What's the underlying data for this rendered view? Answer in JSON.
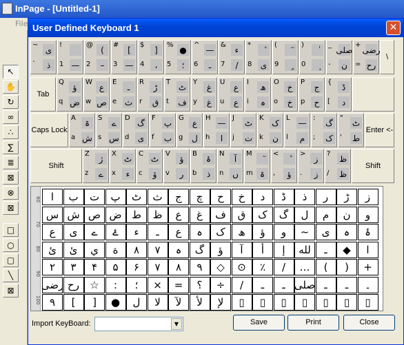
{
  "app": {
    "title": "InPage - [Untitled-1]",
    "menu": "File"
  },
  "dialog": {
    "title": "User Defined Keyboard 1",
    "close": "✕",
    "keyboard": {
      "rows": [
        {
          "keys": [
            {
              "top": "~",
              "bottom": "`",
              "c": [
                "ی",
                "ذ"
              ]
            },
            {
              "top": "!",
              "bottom": "1",
              "c": [
                "",
                "—"
              ]
            },
            {
              "top": "@",
              "bottom": "2",
              "c": [
                "(",
                "–"
              ]
            },
            {
              "top": "#",
              "bottom": "3",
              "c": [
                "[",
                "—"
              ]
            },
            {
              "top": "$",
              "bottom": "4",
              "c": [
                "]",
                "،"
              ]
            },
            {
              "top": "%",
              "bottom": "5",
              "c": [
                "●",
                "؛"
              ]
            },
            {
              "top": "^",
              "bottom": "6",
              "c": [
                "—",
                "ـ"
              ]
            },
            {
              "top": "&",
              "bottom": "7",
              "c": [
                "ء",
                "/"
              ]
            },
            {
              "top": "*",
              "bottom": "8",
              "c": [
                "ٔ",
                "ی"
              ]
            },
            {
              "top": "(",
              "bottom": "9",
              "c": [
                "ٓ",
                "ٍ"
              ]
            },
            {
              "top": ")",
              "bottom": "0",
              "c": [
                "ٰ",
                "ٖ"
              ]
            },
            {
              "top": "_",
              "bottom": "-",
              "c": [
                "صلی",
                "ن"
              ]
            },
            {
              "top": "+",
              "bottom": "=",
              "c": [
                "رضی",
                "رح"
              ]
            }
          ],
          "back": "\\"
        },
        {
          "tab": "Tab",
          "keys": [
            {
              "top": "Q",
              "bottom": "q",
              "c": [
                "ؤ",
                "ض"
              ]
            },
            {
              "top": "W",
              "bottom": "w",
              "c": [
                "ع",
                "ص"
              ]
            },
            {
              "top": "E",
              "bottom": "e",
              "c": [
                "ـ",
                "ث"
              ]
            },
            {
              "top": "R",
              "bottom": "r",
              "c": [
                "ڑ",
                "ق"
              ]
            },
            {
              "top": "T",
              "bottom": "t",
              "c": [
                "ٹ",
                "ف"
              ]
            },
            {
              "top": "Y",
              "bottom": "y",
              "c": [
                "غ",
                "غ"
              ]
            },
            {
              "top": "U",
              "bottom": "u",
              "c": [
                "ع",
                "ع"
              ]
            },
            {
              "top": "I",
              "bottom": "i",
              "c": [
                "ھ",
                "ہ"
              ]
            },
            {
              "top": "O",
              "bottom": "o",
              "c": [
                "خ",
                "خ"
              ]
            },
            {
              "top": "P",
              "bottom": "p",
              "c": [
                "ج",
                "ح"
              ]
            },
            {
              "top": "{",
              "bottom": "[",
              "c": [
                "ڈ",
                "د"
              ]
            }
          ]
        },
        {
          "caps": "Caps Lock",
          "keys": [
            {
              "top": "A",
              "bottom": "a",
              "c": [
                "ۃ",
                "ش"
              ]
            },
            {
              "top": "S",
              "bottom": "s",
              "c": [
                "ے",
                "س"
              ]
            },
            {
              "top": "D",
              "bottom": "d",
              "c": [
                "گ",
                "ی"
              ]
            },
            {
              "top": "F",
              "bottom": "f",
              "c": [
                "پ",
                "ب"
              ]
            },
            {
              "top": "G",
              "bottom": "g",
              "c": [
                "ع",
                "ل"
              ]
            },
            {
              "top": "H",
              "bottom": "h",
              "c": [
                "—",
                "ا"
              ]
            },
            {
              "top": "J",
              "bottom": "j",
              "c": [
                "ٹ",
                "ت"
              ]
            },
            {
              "top": "K",
              "bottom": "k",
              "c": [
                "ک",
                "ن"
              ]
            },
            {
              "top": "L",
              "bottom": "l",
              "c": [
                "—",
                "م"
              ]
            },
            {
              "top": ":",
              "bottom": ";",
              "c": [
                "گ",
                "ک"
              ]
            },
            {
              "top": "\"",
              "bottom": "'",
              "c": [
                "ٹ",
                "ط"
              ]
            }
          ],
          "enter": "Enter <-"
        },
        {
          "shift_left": "Shift",
          "keys": [
            {
              "top": "Z",
              "bottom": "z",
              "c": [
                "ژ",
                "ے"
              ]
            },
            {
              "top": "X",
              "bottom": "x",
              "c": [
                "ٹ",
                "ء"
              ]
            },
            {
              "top": "C",
              "bottom": "c",
              "c": [
                "ٹ",
                "ۆ"
              ]
            },
            {
              "top": "V",
              "bottom": "v",
              "c": [
                "ؤ",
                "ر"
              ]
            },
            {
              "top": "B",
              "bottom": "b",
              "c": [
                "ۂ",
                "ذ"
              ]
            },
            {
              "top": "N",
              "bottom": "n",
              "c": [
                "آ",
                "ں"
              ]
            },
            {
              "top": "M",
              "bottom": "m",
              "c": [
                "ٓ",
                "ۃ"
              ]
            },
            {
              "top": "<",
              "bottom": ",",
              "c": [
                "ٔ",
                "ؤ"
              ]
            },
            {
              "top": ">",
              "bottom": ".",
              "c": [
                "ز",
                "ز"
              ]
            },
            {
              "top": "?",
              "bottom": "/",
              "c": [
                "ظ",
                "ظ"
              ]
            }
          ],
          "shift_right": "Shift"
        }
      ]
    },
    "ruler_labels": [
      "60",
      "70",
      "80",
      "90",
      "100"
    ],
    "glyph_rows": [
      [
        "ا",
        "ب",
        "ت",
        "پ",
        "ٹ",
        "ث",
        "ج",
        "چ",
        "ح",
        "خ",
        "د",
        "ڈ",
        "ذ",
        "ر",
        "ڑ",
        "ز"
      ],
      [
        "س",
        "ش",
        "ص",
        "ض",
        "ط",
        "ظ",
        "ع",
        "غ",
        "ف",
        "ق",
        "ک",
        "گ",
        "ل",
        "م",
        "ن",
        "و"
      ],
      [
        "ع",
        "ی",
        "ے",
        "ۓ",
        "ء",
        "ـ",
        "ع",
        "ہ",
        "ک",
        "ھ",
        "ؤ",
        "و",
        "~",
        "ی",
        "ہ",
        "ۂ"
      ],
      [
        "ئ",
        "ئ",
        "ي",
        "ة",
        "۸",
        "۷",
        "ہ",
        "گ",
        "ؤ",
        "آ",
        "أ",
        "إ",
        "لله",
        "ـ",
        "◆",
        "ا"
      ],
      [
        "۲",
        "۳",
        "۴",
        "۵",
        "۶",
        "۷",
        "۸",
        "۹",
        "◇",
        "⊙",
        "٪",
        "/",
        "…",
        "(",
        ")",
        "+"
      ],
      [
        "رضی",
        "رح",
        "☆",
        ":",
        "؛",
        "×",
        "=",
        "؟",
        "÷",
        "/",
        "ـ",
        "ـ",
        "صلی",
        "ـ",
        "ـ",
        "۔"
      ],
      [
        "۹",
        "[",
        "]",
        "●",
        "ل",
        "لا",
        "لآ",
        "لأ",
        "لإ",
        "▯",
        "▯",
        "▯",
        "▯",
        "▯",
        "▯",
        "▯"
      ]
    ],
    "import_label": "Import KeyBoard:",
    "import_value": "",
    "buttons": {
      "save": "Save",
      "print": "Print",
      "close": "Close"
    }
  }
}
